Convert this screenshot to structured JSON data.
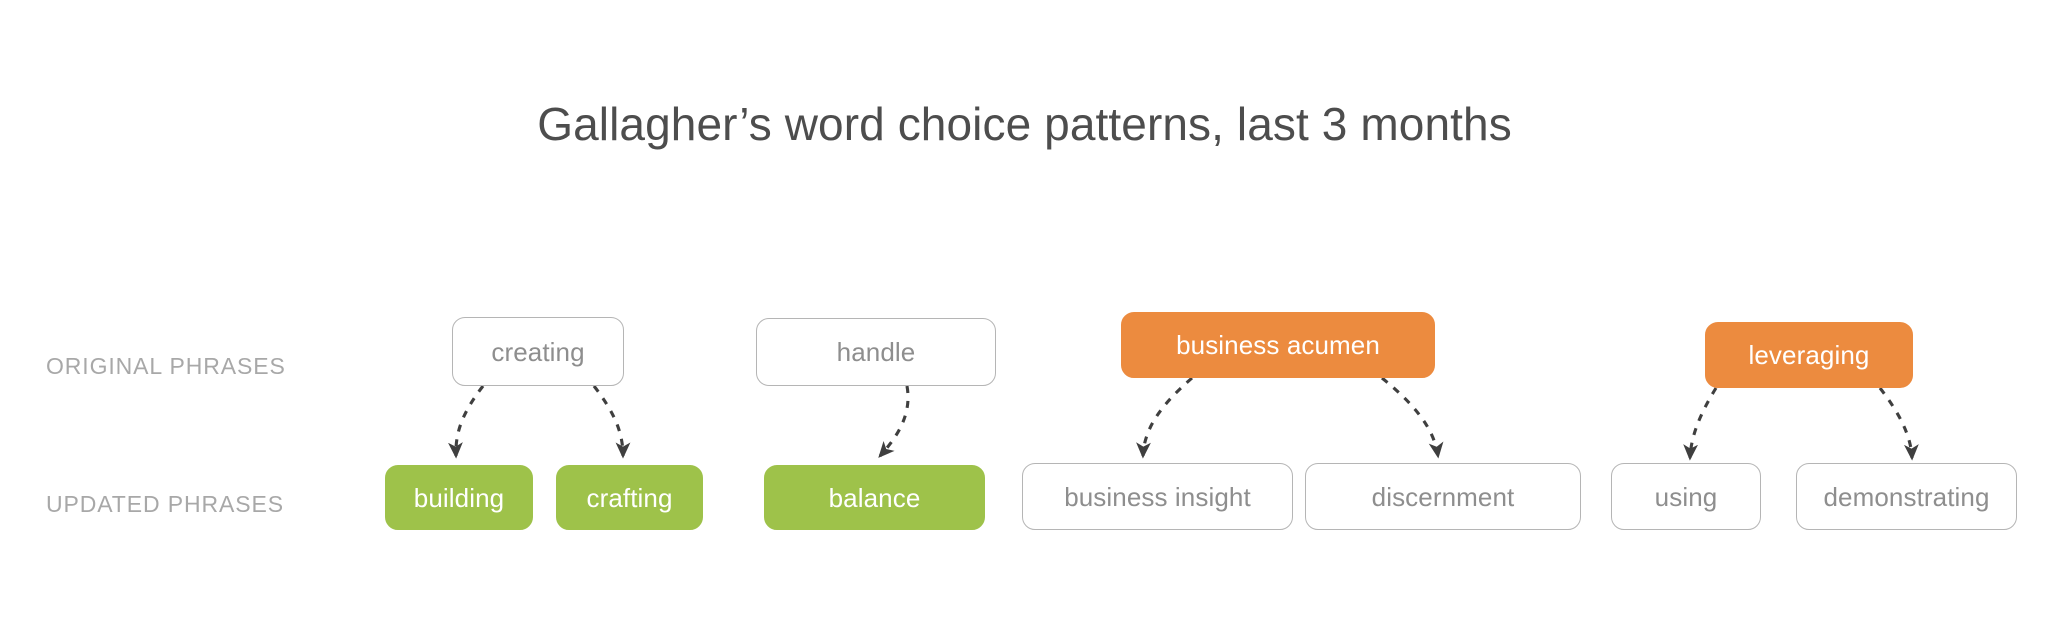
{
  "title": "Gallagher’s word choice patterns, last 3 months",
  "row_labels": {
    "original": "ORIGINAL PHRASES",
    "updated": "UPDATED PHRASES"
  },
  "colors": {
    "background": "#ffffff",
    "title_text": "#4d4d4d",
    "row_label_text": "#a8a8a8",
    "plain_node_border": "#b5b5b5",
    "plain_node_text": "#8e8e8e",
    "green_node_fill": "#9ec24a",
    "orange_node_fill": "#ec8b3f",
    "node_highlight_text": "#ffffff",
    "arrow_stroke": "#3f3f3f"
  },
  "chart_data": {
    "type": "diagram",
    "title": "Gallagher’s word choice patterns, last 3 months",
    "rows": [
      "ORIGINAL PHRASES",
      "UPDATED PHRASES"
    ],
    "groups": [
      {
        "original": "creating",
        "original_style": "plain",
        "updated": [
          "building",
          "crafting"
        ],
        "updated_styles": [
          "green",
          "green"
        ]
      },
      {
        "original": "handle",
        "original_style": "plain",
        "updated": [
          "balance"
        ],
        "updated_styles": [
          "green"
        ]
      },
      {
        "original": "business acumen",
        "original_style": "orange",
        "updated": [
          "business insight",
          "discernment"
        ],
        "updated_styles": [
          "plain",
          "plain"
        ]
      },
      {
        "original": "leveraging",
        "original_style": "orange",
        "updated": [
          "using",
          "demonstrating"
        ],
        "updated_styles": [
          "plain",
          "plain"
        ]
      }
    ],
    "edges": [
      {
        "from": "creating",
        "to": "building"
      },
      {
        "from": "creating",
        "to": "crafting"
      },
      {
        "from": "handle",
        "to": "balance"
      },
      {
        "from": "business acumen",
        "to": "business insight"
      },
      {
        "from": "business acumen",
        "to": "discernment"
      },
      {
        "from": "leveraging",
        "to": "using"
      },
      {
        "from": "leveraging",
        "to": "demonstrating"
      }
    ],
    "legend": [],
    "annotations": []
  },
  "nodes": {
    "creating": "creating",
    "handle": "handle",
    "business_acumen": "business acumen",
    "leveraging": "leveraging",
    "building": "building",
    "crafting": "crafting",
    "balance": "balance",
    "business_insight": "business insight",
    "discernment": "discernment",
    "using": "using",
    "demonstrating": "demonstrating"
  }
}
